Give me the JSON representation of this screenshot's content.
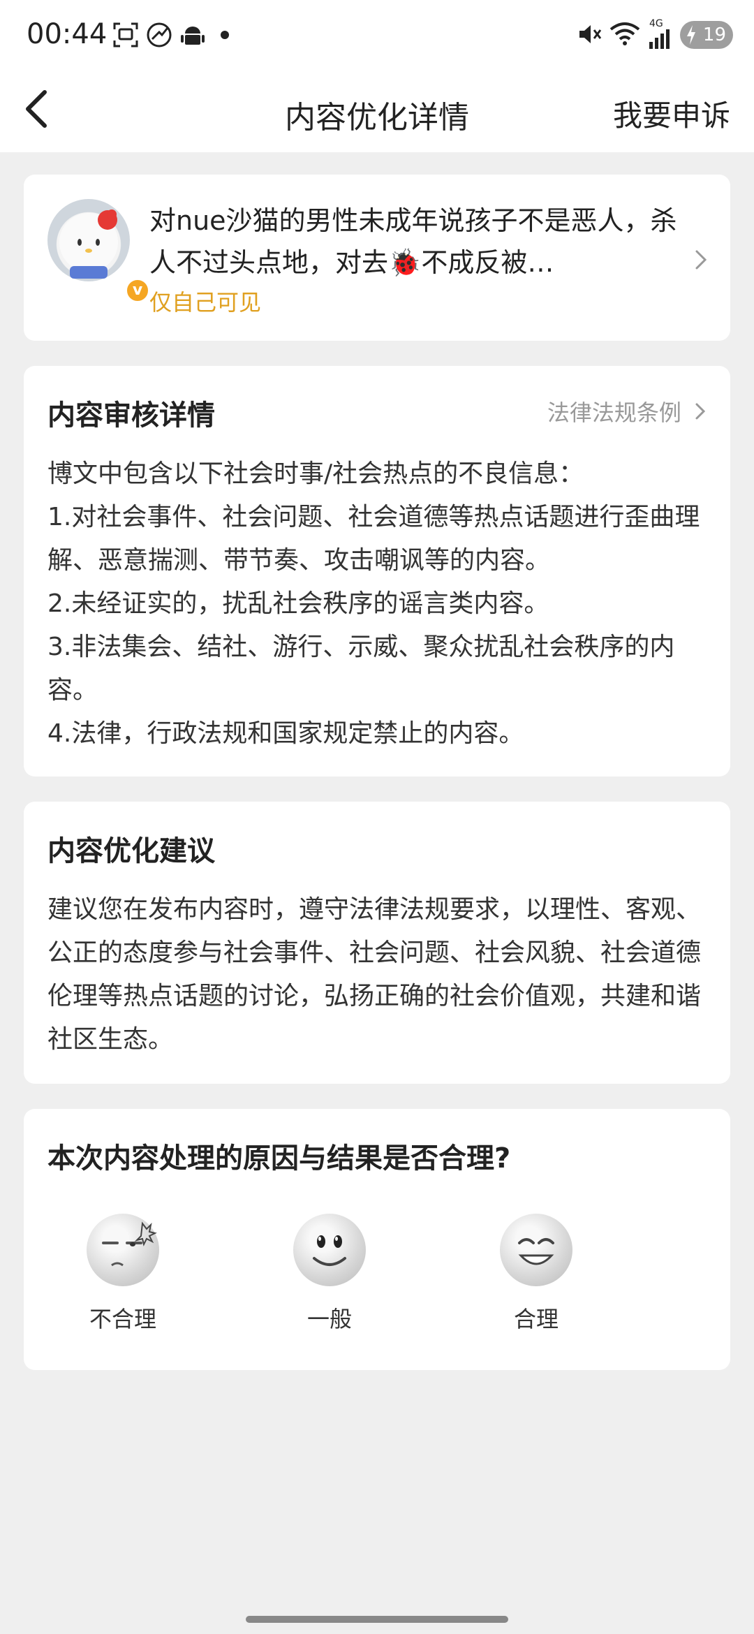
{
  "status_bar": {
    "time": "00:44",
    "battery": "19",
    "icons": [
      "screenshot-icon",
      "weibo-icon",
      "android-icon",
      "mute-icon",
      "wifi-icon",
      "signal-icon"
    ],
    "signal_label": "4G"
  },
  "nav": {
    "title": "内容优化详情",
    "appeal": "我要申诉"
  },
  "post": {
    "text": "对nue沙猫的男性未成年说孩子不是恶人，杀人不过头点地，对去🐞不成反被…",
    "visibility": "仅自己可见",
    "badge": "v"
  },
  "review": {
    "title": "内容审核详情",
    "law_link": "法律法规条例",
    "lines": [
      "博文中包含以下社会时事/社会热点的不良信息：",
      "1.对社会事件、社会问题、社会道德等热点话题进行歪曲理解、恶意揣测、带节奏、攻击嘲讽等的内容。",
      "2.未经证实的，扰乱社会秩序的谣言类内容。",
      "3.非法集会、结社、游行、示威、聚众扰乱社会秩序的内容。",
      "4.法律，行政法规和国家规定禁止的内容。"
    ]
  },
  "suggestion": {
    "title": "内容优化建议",
    "text": "建议您在发布内容时，遵守法律法规要求，以理性、客观、公正的态度参与社会事件、社会问题、社会风貌、社会道德伦理等热点话题的讨论，弘扬正确的社会价值观，共建和谐社区生态。"
  },
  "feedback": {
    "question": "本次内容处理的原因与结果是否合理?",
    "options": [
      {
        "label": "不合理",
        "icon": "angry-face-icon"
      },
      {
        "label": "一般",
        "icon": "neutral-face-icon"
      },
      {
        "label": "合理",
        "icon": "happy-face-icon"
      }
    ]
  },
  "colors": {
    "accent": "#e0a020",
    "background": "#efefef",
    "badge": "#f5a623"
  }
}
